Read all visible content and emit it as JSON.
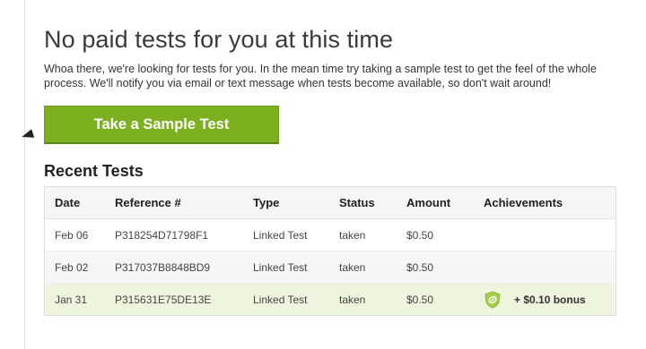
{
  "page": {
    "title": "No paid tests for you at this time",
    "intro": "Whoa there, we're looking for tests for you. In the mean time try taking a sample test to get the feel of the whole process. We'll notify you via email or text message when tests become available, so don't wait around!",
    "cta_label": "Take a Sample Test"
  },
  "recent": {
    "heading": "Recent Tests",
    "columns": [
      "Date",
      "Reference #",
      "Type",
      "Status",
      "Amount",
      "Achievements"
    ],
    "rows": [
      {
        "date": "Feb 06",
        "reference": "P318254D71798F1",
        "type": "Linked Test",
        "status": "taken",
        "amount": "$0.50",
        "achievement": ""
      },
      {
        "date": "Feb 02",
        "reference": "P317037B8848BD9",
        "type": "Linked Test",
        "status": "taken",
        "amount": "$0.50",
        "achievement": ""
      },
      {
        "date": "Jan 31",
        "reference": "P315631E75DE13E",
        "type": "Linked Test",
        "status": "taken",
        "amount": "$0.50",
        "achievement": "+ $0.10 bonus",
        "badge_icon": "shield-badge-icon"
      }
    ]
  },
  "colors": {
    "accent": "#7cb01f",
    "highlight_row": "#eef5df",
    "badge": "#a6cf4a"
  }
}
